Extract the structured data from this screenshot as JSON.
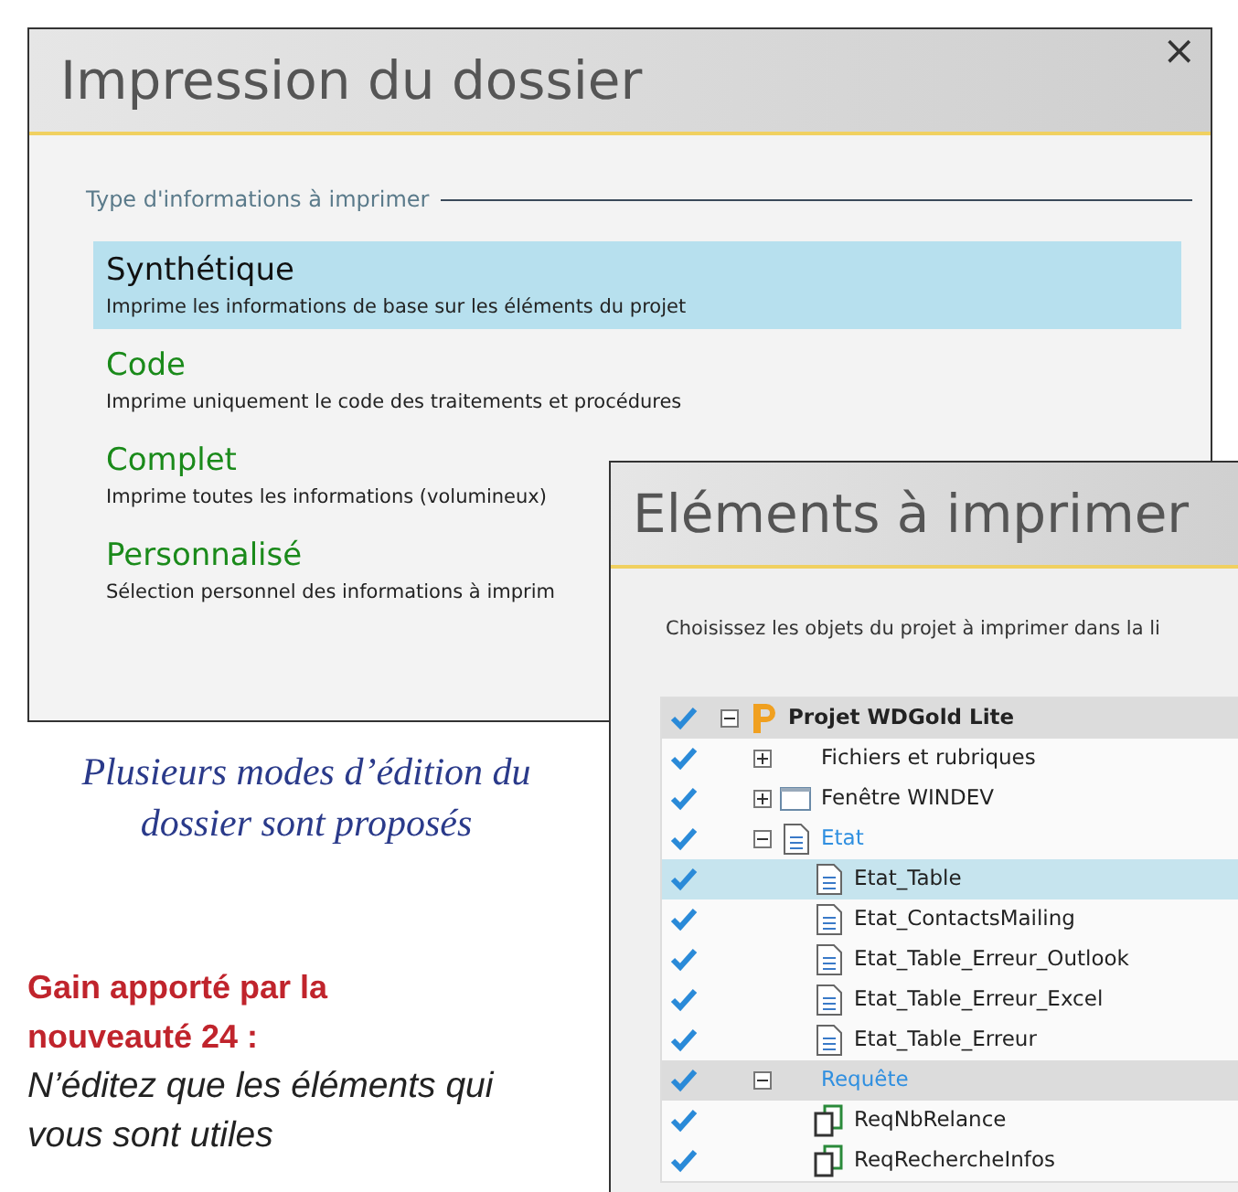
{
  "dialog_1": {
    "title": "Impression du dossier",
    "close": "×",
    "group_label": "Type d'informations à imprimer",
    "options": [
      {
        "title": "Synthétique",
        "description": "Imprime les informations de base sur les éléments du projet",
        "selected": true
      },
      {
        "title": "Code",
        "description": "Imprime uniquement le code des traitements et procédures",
        "selected": false
      },
      {
        "title": "Complet",
        "description": "Imprime toutes les informations (volumineux)",
        "selected": false
      },
      {
        "title": "Personnalisé",
        "description": "Sélection personnel des informations à imprim",
        "selected": false
      }
    ]
  },
  "caption": "Plusieurs modes d’édition du dossier sont proposés",
  "benefit": {
    "heading": "Gain apporté par la nouveauté 24 :",
    "text": "N’éditez que les éléments qui vous sont utiles"
  },
  "dialog_2": {
    "title": "Eléments à imprimer",
    "instruction": "Choisissez les objets du projet à imprimer dans la li",
    "tree": [
      {
        "label": "Projet WDGold Lite",
        "kind": "project",
        "checked": true,
        "expanded": true,
        "selected": false,
        "shaded": true,
        "children": [
          {
            "label": "Fichiers et rubriques",
            "kind": "folder",
            "checked": true,
            "expanded": false,
            "selected": false,
            "shaded": false
          },
          {
            "label": "Fenêtre WINDEV",
            "kind": "window",
            "checked": true,
            "expanded": false,
            "selected": false,
            "shaded": false
          },
          {
            "label": "Etat",
            "kind": "report-folder",
            "checked": true,
            "expanded": true,
            "selected": false,
            "shaded": false,
            "children": [
              {
                "label": "Etat_Table",
                "kind": "report",
                "checked": true,
                "selected": true,
                "shaded": false
              },
              {
                "label": "Etat_ContactsMailing",
                "kind": "report",
                "checked": true,
                "selected": false,
                "shaded": false
              },
              {
                "label": "Etat_Table_Erreur_Outlook",
                "kind": "report",
                "checked": true,
                "selected": false,
                "shaded": false
              },
              {
                "label": "Etat_Table_Erreur_Excel",
                "kind": "report",
                "checked": true,
                "selected": false,
                "shaded": false
              },
              {
                "label": "Etat_Table_Erreur",
                "kind": "report",
                "checked": true,
                "selected": false,
                "shaded": false
              }
            ]
          },
          {
            "label": "Requête",
            "kind": "folder",
            "checked": true,
            "expanded": true,
            "selected": false,
            "shaded": true,
            "children": [
              {
                "label": "ReqNbRelance",
                "kind": "query",
                "checked": true,
                "selected": false,
                "shaded": false
              },
              {
                "label": "ReqRechercheInfos",
                "kind": "query",
                "checked": true,
                "selected": false,
                "shaded": false
              }
            ]
          }
        ]
      }
    ]
  }
}
